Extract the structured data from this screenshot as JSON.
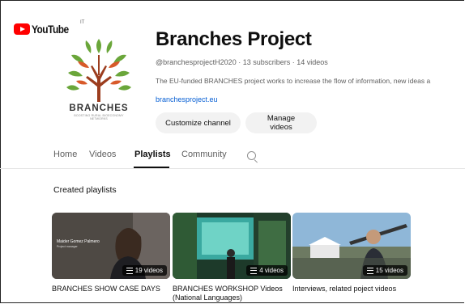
{
  "logo": {
    "name": "YouTube",
    "region": "IT"
  },
  "avatar": {
    "brand": "BRANCHES",
    "tagline": "BOOSTING RURAL BIOECONOMY NETWORKS"
  },
  "channel": {
    "title": "Branches Project",
    "meta": "@branchesprojectH2020 · 13 subscribers · 14 videos",
    "description": "The EU-funded BRANCHES project works to increase the flow of information, new ideas a",
    "link": "branchesproject.eu",
    "customize_label": "Customize channel",
    "manage_label": "Manage videos"
  },
  "tabs": [
    {
      "label": "Home",
      "active": false
    },
    {
      "label": "Videos",
      "active": false
    },
    {
      "label": "Playlists",
      "active": true
    },
    {
      "label": "Community",
      "active": false
    }
  ],
  "section": {
    "title": "Created playlists"
  },
  "playlists": [
    {
      "title": "BRANCHES SHOW CASE DAYS",
      "count": "19 videos",
      "overlay_name": "Maider Gomez Palmero",
      "overlay_role": "Project manager"
    },
    {
      "title": "BRANCHES WORKSHOP Videos (National Languages)",
      "count": "4 videos"
    },
    {
      "title": "Interviews, related poject videos",
      "count": "15 videos"
    }
  ],
  "colors": {
    "accent_red": "#ff0000",
    "link_blue": "#065fd4",
    "chip_bg": "#f2f2f2",
    "secondary_text": "#606060"
  }
}
